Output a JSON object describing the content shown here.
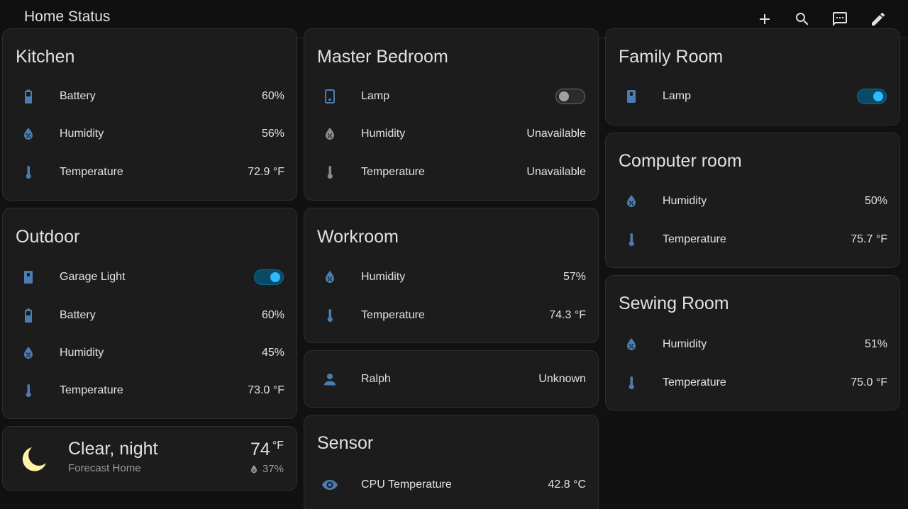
{
  "header": {
    "title": "Home Status"
  },
  "colors": {
    "icon_blue": "#4b7db2",
    "icon_gray": "#8a8a8a",
    "toggle_on": "#2fbaff",
    "moon": "#fff3a8"
  },
  "kitchen": {
    "title": "Kitchen",
    "rows": [
      {
        "icon": "battery-icon",
        "label": "Battery",
        "value": "60%"
      },
      {
        "icon": "humidity-icon",
        "label": "Humidity",
        "value": "56%"
      },
      {
        "icon": "thermometer-icon",
        "label": "Temperature",
        "value": "72.9 °F"
      }
    ]
  },
  "outdoor": {
    "title": "Outdoor",
    "rows": [
      {
        "icon": "light-switch-icon",
        "label": "Garage Light",
        "state": "on"
      },
      {
        "icon": "battery-icon",
        "label": "Battery",
        "value": "60%"
      },
      {
        "icon": "humidity-icon",
        "label": "Humidity",
        "value": "45%"
      },
      {
        "icon": "thermometer-icon",
        "label": "Temperature",
        "value": "73.0 °F"
      }
    ]
  },
  "weather": {
    "condition": "Clear, night",
    "location": "Forecast Home",
    "temperature": "74",
    "unit": "°F",
    "humidity": "37%"
  },
  "master_bedroom": {
    "title": "Master Bedroom",
    "rows": [
      {
        "icon": "lamp-switch-icon",
        "label": "Lamp",
        "state": "off"
      },
      {
        "icon": "humidity-icon",
        "label": "Humidity",
        "value": "Unavailable"
      },
      {
        "icon": "thermometer-icon",
        "label": "Temperature",
        "value": "Unavailable"
      }
    ]
  },
  "workroom": {
    "title": "Workroom",
    "rows": [
      {
        "icon": "humidity-icon",
        "label": "Humidity",
        "value": "57%"
      },
      {
        "icon": "thermometer-icon",
        "label": "Temperature",
        "value": "74.3 °F"
      }
    ]
  },
  "person": {
    "label": "Ralph",
    "value": "Unknown"
  },
  "sensor": {
    "title": "Sensor",
    "rows": [
      {
        "icon": "eye-icon",
        "label": "CPU Temperature",
        "value": "42.8 °C"
      }
    ]
  },
  "family_room": {
    "title": "Family Room",
    "rows": [
      {
        "icon": "light-switch-icon",
        "label": "Lamp",
        "state": "on"
      }
    ]
  },
  "computer_room": {
    "title": "Computer room",
    "rows": [
      {
        "icon": "humidity-icon",
        "label": "Humidity",
        "value": "50%"
      },
      {
        "icon": "thermometer-icon",
        "label": "Temperature",
        "value": "75.7 °F"
      }
    ]
  },
  "sewing_room": {
    "title": "Sewing Room",
    "rows": [
      {
        "icon": "humidity-icon",
        "label": "Humidity",
        "value": "51%"
      },
      {
        "icon": "thermometer-icon",
        "label": "Temperature",
        "value": "75.0 °F"
      }
    ]
  }
}
